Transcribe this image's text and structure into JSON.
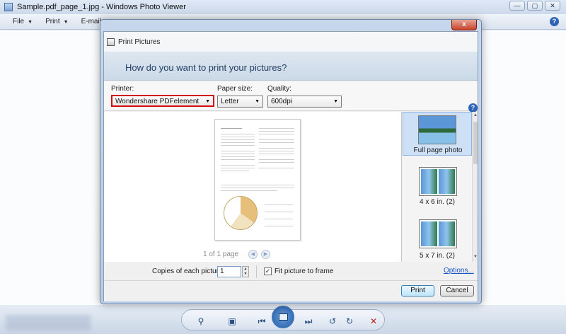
{
  "window": {
    "title": "Sample.pdf_page_1.jpg - Windows Photo Viewer",
    "controls": [
      "—",
      "▢",
      "✕"
    ]
  },
  "menu": {
    "items": [
      {
        "label": "File",
        "arrow": "▼"
      },
      {
        "label": "Print",
        "arrow": "▼"
      },
      {
        "label": "E-mail",
        "arrow": ""
      }
    ],
    "help": "?"
  },
  "dialog": {
    "title": "Print Pictures",
    "close": "x",
    "heading": "How do you want to print your pictures?",
    "printer": {
      "label": "Printer:",
      "value": "Wondershare PDFelement"
    },
    "paper_size": {
      "label": "Paper size:",
      "value": "Letter"
    },
    "quality": {
      "label": "Quality:",
      "value": "600dpi"
    },
    "help": "?",
    "page_count": "1 of 1 page",
    "layouts": [
      {
        "label": "Full page photo",
        "selected": true
      },
      {
        "label": "4 x 6 in. (2)",
        "selected": false
      },
      {
        "label": "5 x 7 in. (2)",
        "selected": false
      }
    ],
    "copies_label": "Copies of each picture:",
    "copies_value": "1",
    "fit_label": "Fit picture to frame",
    "fit_checked": true,
    "fit_mark": "✓",
    "options_link": "Options...",
    "print_button": "Print",
    "cancel_button": "Cancel"
  },
  "colors": {
    "accent": "#2f63b6",
    "printer_highlight": "#d20f0f",
    "link": "#1a55c4"
  }
}
